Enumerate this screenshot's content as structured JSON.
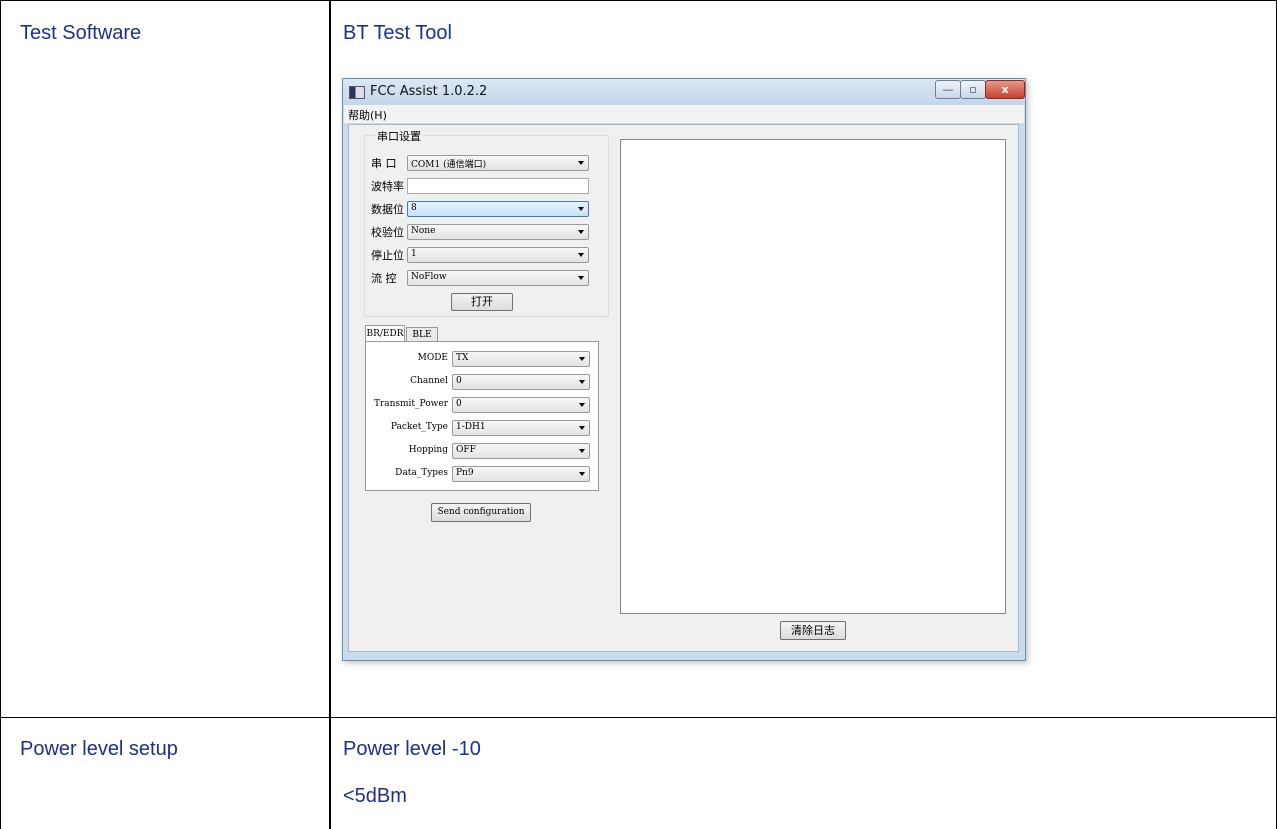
{
  "table": {
    "row1": {
      "label": "Test Software",
      "value": "BT Test Tool"
    },
    "row2": {
      "label": "Power level setup",
      "value_line1": "Power level -10",
      "value_line2": "<5dBm"
    }
  },
  "app": {
    "title": "FCC Assist 1.0.2.2",
    "window_buttons": {
      "minimize": "—",
      "maximize": "▫",
      "close": "x"
    },
    "menu": {
      "help": "帮助(H)"
    },
    "serial": {
      "group_title": "串口设置",
      "port_label": "串  口",
      "port_value": "COM1 (通信端口)",
      "baud_label": "波特率",
      "baud_value": "",
      "databits_label": "数据位",
      "databits_value": "8",
      "parity_label": "校验位",
      "parity_value": "None",
      "stopbits_label": "停止位",
      "stopbits_value": "1",
      "flow_label": "流  控",
      "flow_value": "NoFlow",
      "open_button": "打开"
    },
    "tabs": [
      "BR/EDR",
      "BLE"
    ],
    "config": {
      "mode_label": "MODE",
      "mode_value": "TX",
      "channel_label": "Channel",
      "channel_value": "0",
      "power_label": "Transmit_Power",
      "power_value": "0",
      "packet_label": "Packet_Type",
      "packet_value": "1-DH1",
      "hopping_label": "Hopping",
      "hopping_value": "OFF",
      "datatype_label": "Data_Types",
      "datatype_value": "Pn9"
    },
    "send_button": "Send configuration",
    "clear_log_button": "清除日志"
  },
  "colors": {
    "text_blue": "#1f2f8f"
  }
}
